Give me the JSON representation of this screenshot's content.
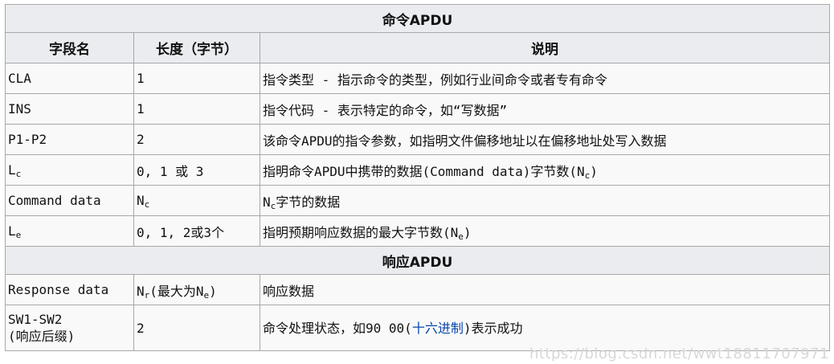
{
  "table": {
    "command_title": "命令APDU",
    "headers": {
      "field": "字段名",
      "length": "长度（字节）",
      "desc": "说明"
    },
    "rows": [
      {
        "field": "CLA",
        "length": "1",
        "desc": "指令类型 - 指示命令的类型，例如行业间命令或者专有命令"
      },
      {
        "field": "INS",
        "length": "1",
        "desc": "指令代码 - 表示特定的命令，如“写数据”"
      },
      {
        "field": "P1-P2",
        "length": "2",
        "desc": "该命令APDU的指令参数，如指明文件偏移地址以在偏移地址处写入数据"
      },
      {
        "field_main": "L",
        "field_sub": "c",
        "length": "0, 1 或 3",
        "desc_a": "指明命令APDU中携带的数据(Command data)字节数(N",
        "desc_sub": "c",
        "desc_b": ")"
      },
      {
        "field": "Command data",
        "length_main": "N",
        "length_sub": "c",
        "desc_main": "N",
        "desc_sub": "c",
        "desc_tail": "字节的数据"
      },
      {
        "field_main": "L",
        "field_sub": "e",
        "length": "0, 1, 2或3个",
        "desc_a": "指明预期响应数据的最大字节数(N",
        "desc_sub": "e",
        "desc_b": ")"
      }
    ],
    "response_title": "响应APDU",
    "response_rows": [
      {
        "field": "Response data",
        "len_a": "N",
        "len_sub1": "r",
        "len_b": "(最大为N",
        "len_sub2": "e",
        "len_c": ")",
        "desc": "响应数据"
      },
      {
        "field_line1": "SW1-SW2",
        "field_line2": "(响应后缀)",
        "length": "2",
        "desc_a": "命令处理状态，如90 00(",
        "desc_link": "十六进制",
        "desc_b": ")表示成功"
      }
    ]
  },
  "watermark": "https://blog.csdn.net/wwt18811707971"
}
